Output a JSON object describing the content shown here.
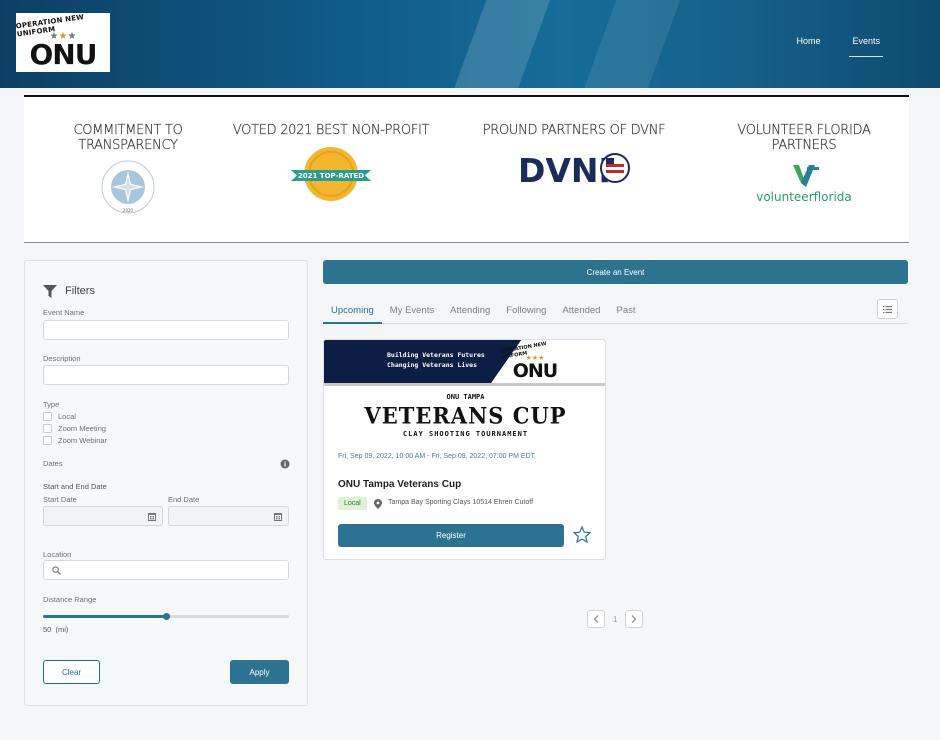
{
  "header": {
    "logo": {
      "arc_text": "OPERATION NEW UNIFORM",
      "word": "ONU"
    },
    "nav": [
      {
        "label": "Home"
      },
      {
        "label": "Events",
        "active": true
      }
    ]
  },
  "banner": {
    "columns": [
      {
        "title": "COMMITMENT TO TRANSPARENCY",
        "badge": "platinum-seal-of-transparency",
        "badge_text": "2020"
      },
      {
        "title": "VOTED 2021 BEST NON-PROFIT",
        "badge": "greatnonprofits-badge",
        "badge_text": "2021 TOP-RATED"
      },
      {
        "title": "PROUND PARTNERS OF DVNF",
        "badge": "dvnf-logo",
        "badge_text": "DVNF"
      },
      {
        "title": "VOLUNTEER FLORIDA PARTNERS",
        "badge": "volunteerflorida-logo",
        "badge_text": "volunteerflorida"
      }
    ]
  },
  "filters": {
    "heading": "Filters",
    "event_name_label": "Event Name",
    "description_label": "Description",
    "type_label": "Type",
    "types": [
      "Local",
      "Zoom Meeting",
      "Zoom Webinar"
    ],
    "dates_label": "Dates",
    "start_end_label": "Start and End Date",
    "start_label": "Start Date",
    "end_label": "End Date",
    "location_label": "Location",
    "distance_label": "Distance Range",
    "distance_value": "50  (mi)",
    "distance_fraction": 0.5,
    "clear_label": "Clear",
    "apply_label": "Apply"
  },
  "main": {
    "create_label": "Create an Event",
    "tabs": [
      "Upcoming",
      "My Events",
      "Attending",
      "Following",
      "Attended",
      "Past"
    ],
    "active_tab": "Upcoming",
    "card": {
      "image": {
        "line1": "Building Veterans Futures",
        "line2": "Changing Veterans Lives",
        "logo_word": "ONU",
        "sub": "ONU TAMPA",
        "big": "VETERANS CUP",
        "small": "CLAY SHOOTING TOURNAMENT"
      },
      "date": "Fri, Sep 09, 2022, 10:00 AM - Fri, Sep 09, 2022, 07:00 PM EDT",
      "title": "ONU Tampa Veterans Cup",
      "badge": "Local",
      "location": "Tampa Bay Sporting Clays 10514 Ehren Cutoff",
      "register_label": "Register"
    },
    "pagination": {
      "current": "1"
    }
  },
  "colors": {
    "primary": "#2b7390",
    "header": "#0f5a86"
  }
}
